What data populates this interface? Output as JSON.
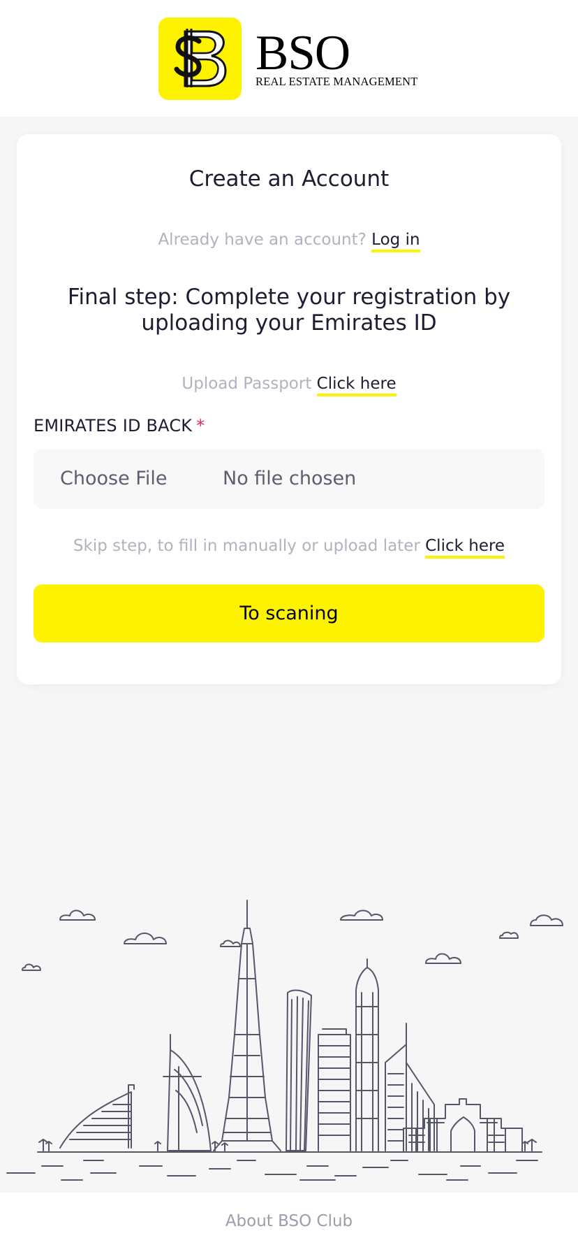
{
  "brand": {
    "name": "BSO",
    "subtitle": "REAL ESTATE MANAGEMENT",
    "accent_color": "#fdf200"
  },
  "page": {
    "title": "Create an Account",
    "login_prompt": "Already have an account?",
    "login_link": "Log in",
    "heading": "Final step: Complete your registration by uploading your Emirates ID",
    "passport_prompt": "Upload Passport",
    "passport_link": "Click here"
  },
  "form": {
    "field_label": "EMIRATES ID BACK",
    "required_mark": "*",
    "file_button": "Choose File",
    "file_status": "No file chosen"
  },
  "skip": {
    "text": "Skip step, to fill in manually or upload later",
    "link": "Click here"
  },
  "actions": {
    "submit_label": "To scaning"
  },
  "footer": {
    "link": "About BSO Club"
  },
  "icons": {
    "logo": "bso-dollar-logo-icon",
    "illustration": "dubai-skyline-illustration"
  }
}
